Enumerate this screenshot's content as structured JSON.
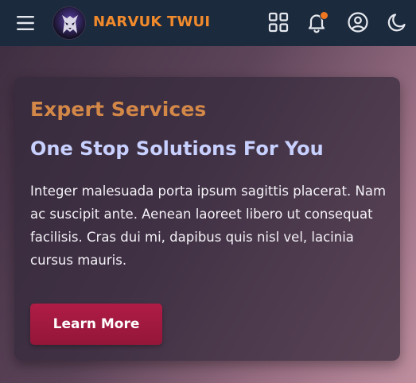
{
  "header": {
    "brand": "NARVUK TWUI",
    "icons": {
      "menu": "hamburger-menu-icon",
      "logo": "wolf-logo",
      "apps": "grid-apps-icon",
      "notifications": "bell-icon",
      "account": "user-circle-icon",
      "theme": "moon-icon"
    },
    "has_notification_badge": true
  },
  "hero": {
    "eyebrow": "Expert Services",
    "title": "One Stop Solutions For You",
    "description": "Integer malesuada porta ipsum sagittis placerat. Nam ac suscipit ante. Aenean laoreet libero ut consequat facilisis. Cras dui mi, dapibus quis nisl vel, lacinia cursus mauris.",
    "cta_label": "Learn More"
  },
  "colors": {
    "navbar_bg": "#1c2a3d",
    "brand": "#f08a2c",
    "eyebrow": "#d48848",
    "title": "#c8d0ff",
    "cta_bg": "#a81a42",
    "badge": "#f07722"
  }
}
